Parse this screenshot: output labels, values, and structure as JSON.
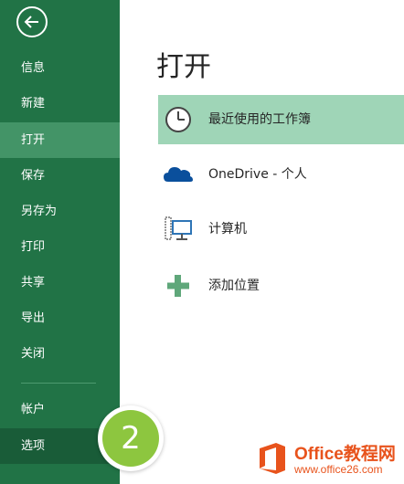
{
  "sidebar": {
    "back_icon": "back-arrow-icon",
    "items": [
      {
        "label": "信息"
      },
      {
        "label": "新建"
      },
      {
        "label": "打开",
        "selected": true
      },
      {
        "label": "保存"
      },
      {
        "label": "另存为"
      },
      {
        "label": "打印"
      },
      {
        "label": "共享"
      },
      {
        "label": "导出"
      },
      {
        "label": "关闭"
      },
      {
        "label": "帐户"
      },
      {
        "label": "选项"
      }
    ]
  },
  "main": {
    "title": "打开",
    "options": [
      {
        "label": "最近使用的工作簿",
        "icon": "clock-icon",
        "selected": true
      },
      {
        "label": "OneDrive - 个人",
        "icon": "cloud-icon"
      },
      {
        "label": "计算机",
        "icon": "computer-icon"
      },
      {
        "label": "添加位置",
        "icon": "plus-icon"
      }
    ]
  },
  "badge": {
    "text": "2",
    "color": "#8dc63f"
  },
  "watermark": {
    "brand": "Office教程网",
    "url": "www.office26.com"
  },
  "colors": {
    "sidebar": "#217346",
    "sidebar_selected": "#439467",
    "option_selected": "#9fd5b7",
    "accent": "#e8531c"
  }
}
